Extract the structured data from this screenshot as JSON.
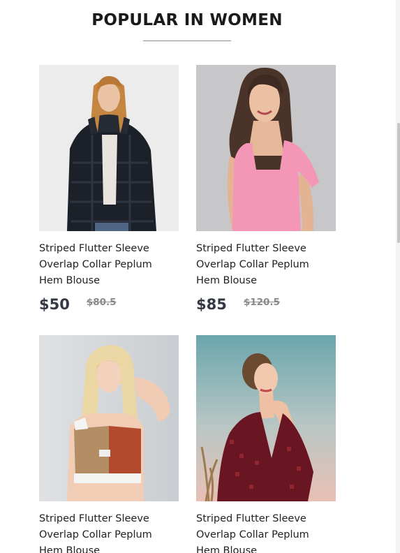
{
  "section": {
    "title": "POPULAR IN WOMEN"
  },
  "products": [
    {
      "name": "Striped Flutter Sleeve Overlap Collar Peplum Hem Blouse",
      "price": "$50",
      "old_price": "$80.5",
      "image": "woman-black-fur-jacket"
    },
    {
      "name": "Striped Flutter Sleeve Overlap Collar Peplum Hem Blouse",
      "price": "$85",
      "old_price": "$120.5",
      "image": "woman-pink-top"
    },
    {
      "name": "Striped Flutter Sleeve Overlap Collar Peplum Hem Blouse",
      "price": "",
      "old_price": "",
      "image": "woman-sports-crop-top"
    },
    {
      "name": "Striped Flutter Sleeve Overlap Collar Peplum Hem Blouse",
      "price": "",
      "old_price": "",
      "image": "woman-red-wrap-dress"
    }
  ],
  "colors": {
    "heading": "#1a1a1a",
    "price": "#333844",
    "old_price": "#8a8a8a"
  }
}
